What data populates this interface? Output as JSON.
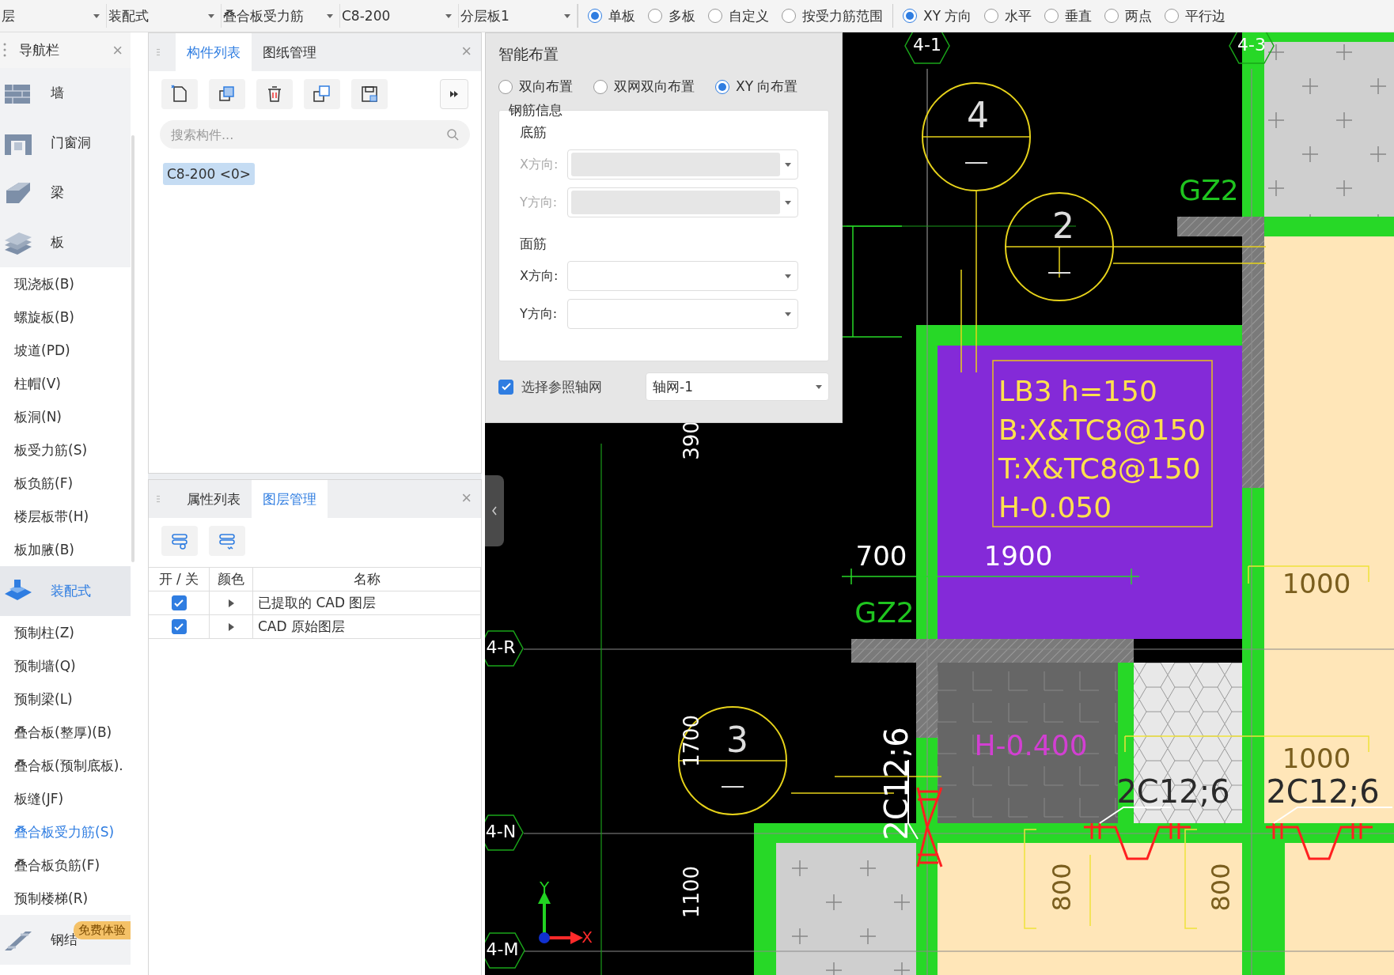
{
  "toolbar": {
    "dropdowns": [
      "层",
      "装配式",
      "叠合板受力筋",
      "C8-200",
      "分层板1"
    ],
    "mode_radios": [
      {
        "label": "单板",
        "selected": true
      },
      {
        "label": "多板",
        "selected": false
      },
      {
        "label": "自定义",
        "selected": false
      },
      {
        "label": "按受力筋范围",
        "selected": false
      }
    ],
    "direction_radios": [
      {
        "label": "XY 方向",
        "selected": true
      },
      {
        "label": "水平",
        "selected": false
      },
      {
        "label": "垂直",
        "selected": false
      },
      {
        "label": "两点",
        "selected": false
      },
      {
        "label": "平行边",
        "selected": false
      }
    ]
  },
  "nav": {
    "title": "导航栏",
    "close": "×",
    "items": [
      {
        "label": "墙",
        "selected": false
      },
      {
        "label": "门窗洞",
        "selected": false
      },
      {
        "label": "梁",
        "selected": false
      },
      {
        "label": "板",
        "selected": false,
        "children": [
          {
            "label": "现浇板(B)",
            "selected": false
          },
          {
            "label": "螺旋板(B)",
            "selected": false
          },
          {
            "label": "坡道(PD)",
            "selected": false
          },
          {
            "label": "柱帽(V)",
            "selected": false
          },
          {
            "label": "板洞(N)",
            "selected": false
          },
          {
            "label": "板受力筋(S)",
            "selected": false
          },
          {
            "label": "板负筋(F)",
            "selected": false
          },
          {
            "label": "楼层板带(H)",
            "selected": false
          },
          {
            "label": "板加腋(B)",
            "selected": false
          }
        ]
      },
      {
        "label": "装配式",
        "selected": true,
        "children": [
          {
            "label": "预制柱(Z)",
            "selected": false
          },
          {
            "label": "预制墙(Q)",
            "selected": false
          },
          {
            "label": "预制梁(L)",
            "selected": false
          },
          {
            "label": "叠合板(整厚)(B)",
            "selected": false
          },
          {
            "label": "叠合板(预制底板).",
            "selected": false
          },
          {
            "label": "板缝(JF)",
            "selected": false
          },
          {
            "label": "叠合板受力筋(S)",
            "selected": true
          },
          {
            "label": "叠合板负筋(F)",
            "selected": false
          },
          {
            "label": "预制楼梯(R)",
            "selected": false
          }
        ]
      },
      {
        "label": "钢结",
        "selected": false,
        "badge": "免费体验"
      }
    ]
  },
  "component_panel": {
    "tabs": [
      {
        "label": "构件列表",
        "selected": true
      },
      {
        "label": "图纸管理",
        "selected": false
      }
    ],
    "close": "×",
    "search": {
      "placeholder": "搜索构件..."
    },
    "items": [
      {
        "label": "C8-200 <0>",
        "selected": true
      }
    ]
  },
  "layer_panel": {
    "tabs": [
      {
        "label": "属性列表",
        "selected": false
      },
      {
        "label": "图层管理",
        "selected": true
      }
    ],
    "close": "×",
    "columns": [
      "开 / 关",
      "颜色",
      "名称"
    ],
    "rows": [
      {
        "on": true,
        "name": "已提取的 CAD 图层"
      },
      {
        "on": true,
        "name": "CAD 原始图层"
      }
    ]
  },
  "smart_layout": {
    "title": "智能布置",
    "radios": [
      {
        "label": "双向布置",
        "selected": false
      },
      {
        "label": "双网双向布置",
        "selected": false
      },
      {
        "label": "XY 向布置",
        "selected": true
      }
    ],
    "group": "钢筋信息",
    "sections": [
      {
        "heading": "底筋",
        "fields": [
          {
            "label": "X方向:",
            "disabled": true
          },
          {
            "label": "Y方向:",
            "disabled": true
          }
        ]
      },
      {
        "heading": "面筋",
        "fields": [
          {
            "label": "X方向:",
            "disabled": false
          },
          {
            "label": "Y方向:",
            "disabled": false
          }
        ]
      }
    ],
    "reference": {
      "label": "选择参照轴网",
      "checked": true,
      "value": "轴网-1"
    }
  },
  "drawing": {
    "labels": [
      {
        "kind": "axis",
        "text": "4-1"
      },
      {
        "kind": "axis",
        "text": "4-3"
      },
      {
        "kind": "axis",
        "text": "4-R"
      },
      {
        "kind": "axis",
        "text": "4-N"
      },
      {
        "kind": "axis",
        "text": "4-M"
      },
      {
        "kind": "callout",
        "text": "4"
      },
      {
        "kind": "callout",
        "text": "2"
      },
      {
        "kind": "callout",
        "text": "3"
      },
      {
        "kind": "tag",
        "text": "GZ2"
      },
      {
        "kind": "tag",
        "text": "GZ2"
      },
      {
        "kind": "note",
        "text": "LB3 h=150"
      },
      {
        "kind": "note",
        "text": "B:X&TC8@150"
      },
      {
        "kind": "note",
        "text": "T:X&TC8@150"
      },
      {
        "kind": "note",
        "text": "H-0.050"
      },
      {
        "kind": "dim",
        "text": "700"
      },
      {
        "kind": "dim",
        "text": "1900"
      },
      {
        "kind": "dim-vertical",
        "text": "390"
      },
      {
        "kind": "dim-vertical",
        "text": "1700"
      },
      {
        "kind": "dim-vertical",
        "text": "1100"
      },
      {
        "kind": "elevation",
        "text": "H-0.400"
      },
      {
        "kind": "dim-faint",
        "text": "1000"
      },
      {
        "kind": "dim-faint",
        "text": "1000"
      },
      {
        "kind": "rebar-vertical",
        "text": "2C12;6"
      },
      {
        "kind": "rebar",
        "text": "2C12;6"
      },
      {
        "kind": "rebar",
        "text": "2C12;6"
      },
      {
        "kind": "dim-faint-vertical",
        "text": "800"
      },
      {
        "kind": "dim-faint-vertical",
        "text": "800"
      },
      {
        "kind": "axis-y",
        "text": "Y"
      },
      {
        "kind": "axis-x",
        "text": "X"
      }
    ]
  }
}
